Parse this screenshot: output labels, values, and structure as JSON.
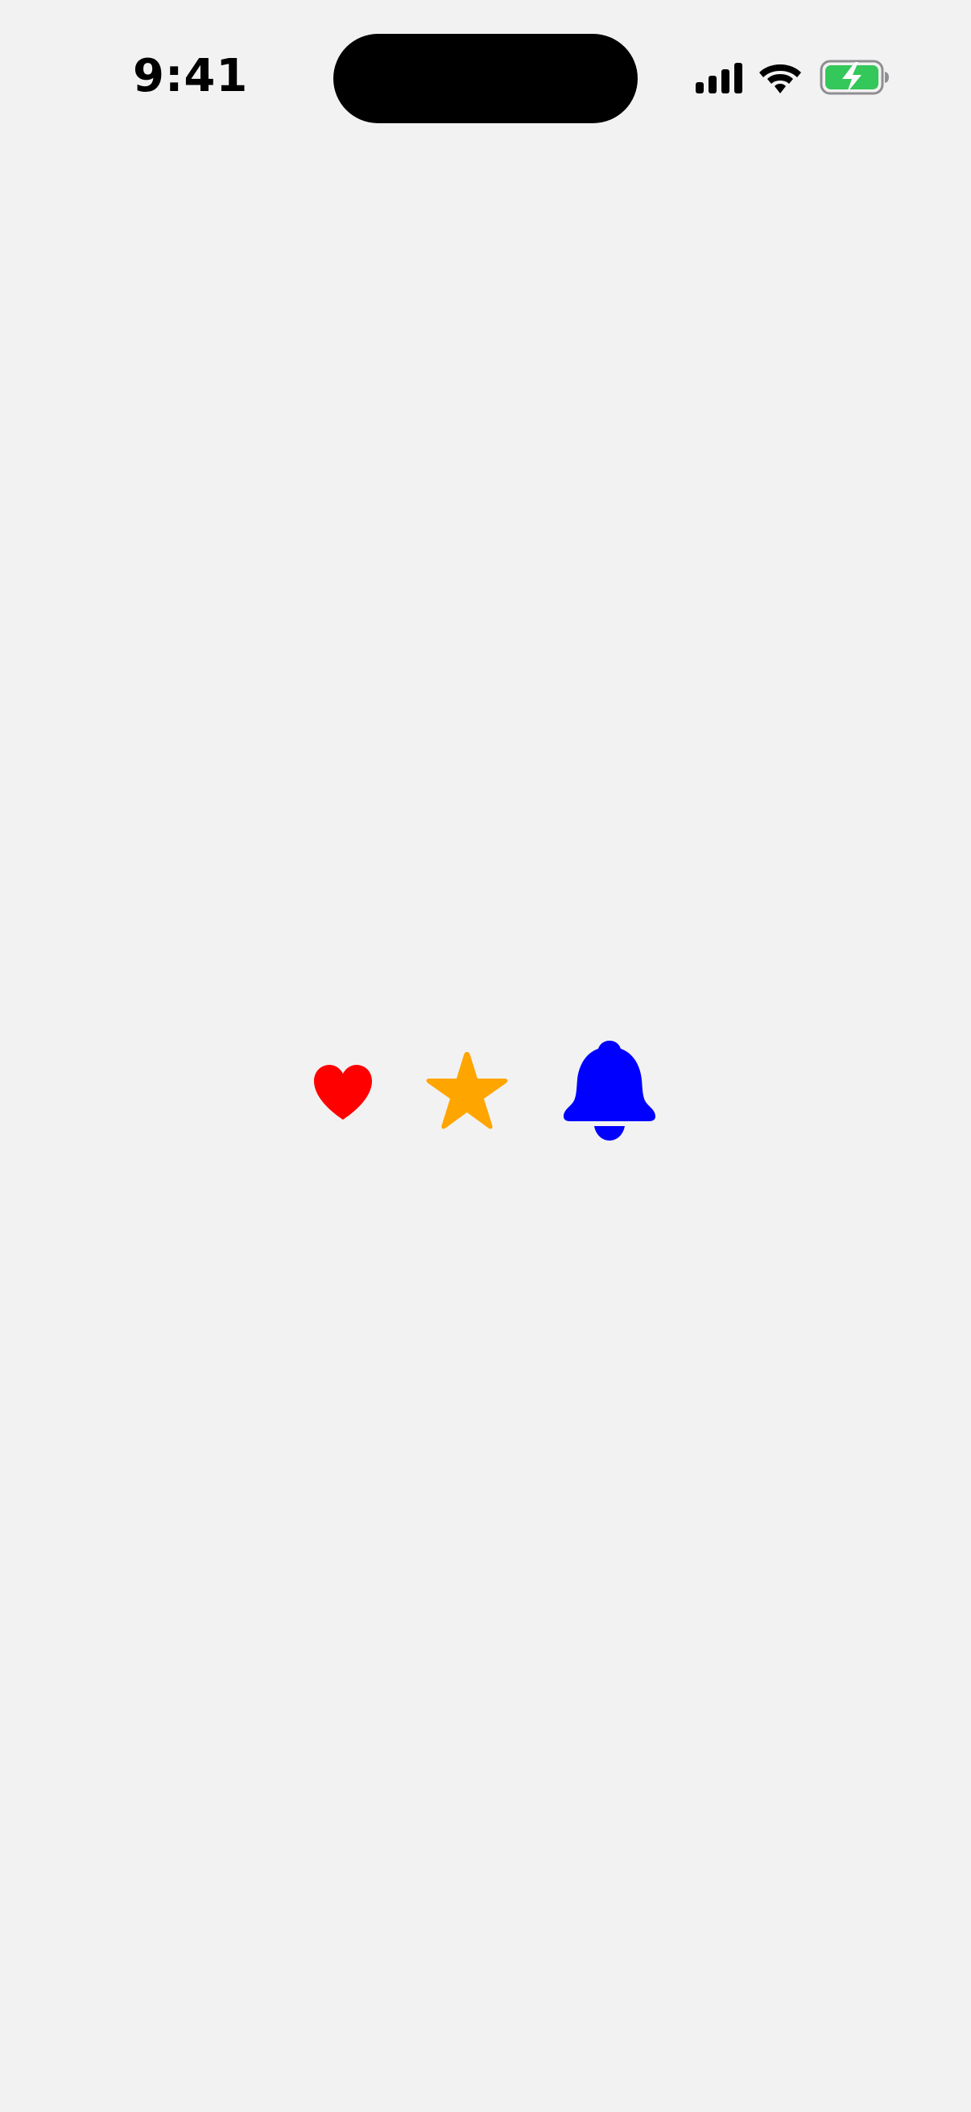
{
  "status_bar": {
    "time": "9:41",
    "signal_icon": "cellular-signal-icon",
    "wifi_icon": "wifi-icon",
    "battery_icon": "battery-charging-icon",
    "battery_color": "#34c759"
  },
  "content": {
    "icons": [
      {
        "name": "heart-icon",
        "color": "#ff0000"
      },
      {
        "name": "star-icon",
        "color": "#ffa500"
      },
      {
        "name": "bell-icon",
        "color": "#0000ff"
      }
    ]
  }
}
